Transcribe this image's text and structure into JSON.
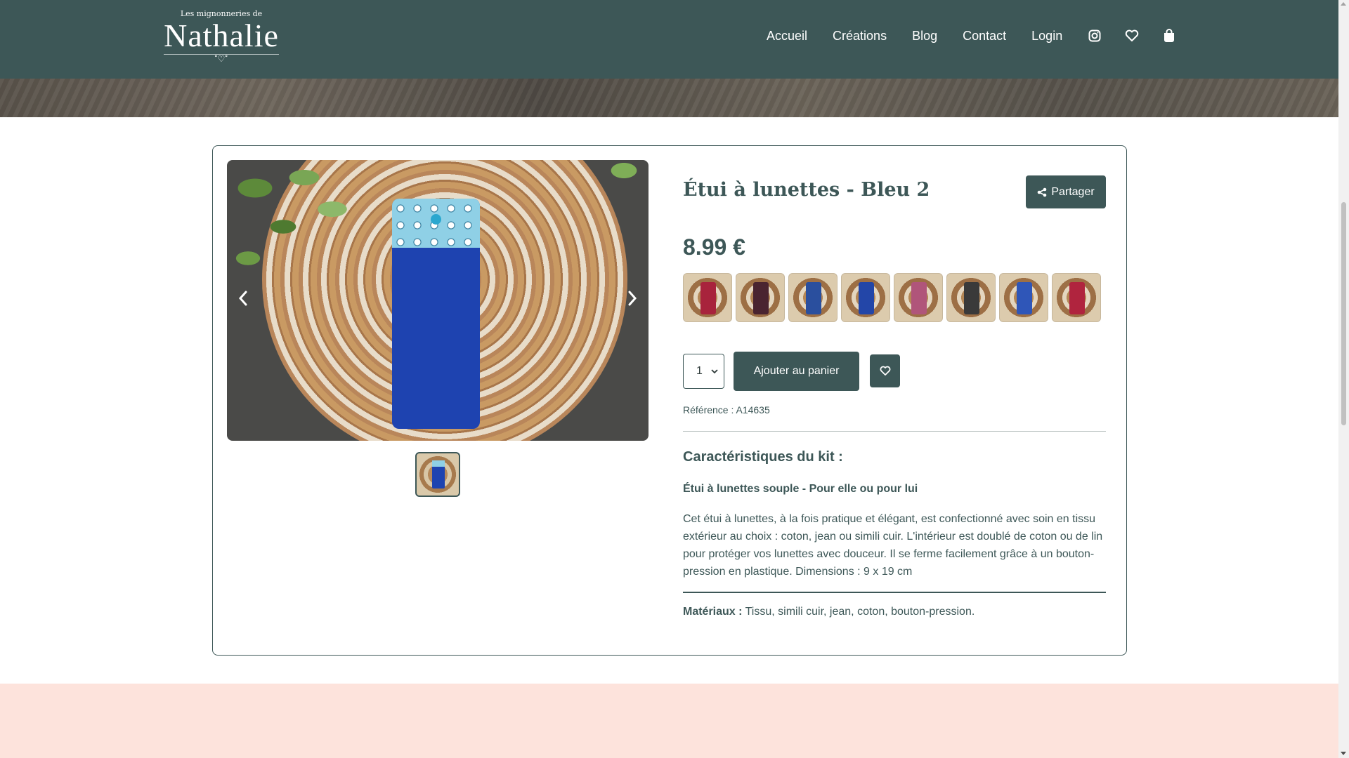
{
  "header": {
    "logo_small": "Les mignonneries de",
    "logo_big": "Nathalie",
    "logo_deco": "˚♡˚",
    "nav": [
      "Accueil",
      "Créations",
      "Blog",
      "Contact",
      "Login"
    ],
    "icons": [
      "instagram-icon",
      "heart-icon",
      "shopping-bag-icon"
    ]
  },
  "product": {
    "title": "Étui à lunettes - Bleu 2",
    "share_label": "Partager",
    "price": "8.99 €",
    "quantity": "1",
    "add_to_cart": "Ajouter au panier",
    "reference": "Référence : A14635",
    "section_title": "Caractéristiques du kit :",
    "subtitle": "Étui à lunettes souple - Pour elle ou pour lui",
    "description": "Cet étui à lunettes, à la fois pratique et élégant, est confectionné avec soin en tissu extérieur au choix : coton, jean ou simili cuir. L'intérieur est doublé de coton ou de lin pour protéger vos lunettes avec douceur. Il se ferme facilement grâce à un bouton-pression en plastique. Dimensions : 9 x 19 cm",
    "materials_label": "Matériaux :",
    "materials_value": " Tissu, simili cuir, jean, coton, bouton-pression."
  },
  "variants": [
    {
      "color": "#a8233c"
    },
    {
      "color": "#4a2430"
    },
    {
      "color": "#2a4f9e"
    },
    {
      "color": "#2346a8"
    },
    {
      "color": "#b0557a"
    },
    {
      "color": "#3a3a3a"
    },
    {
      "color": "#2f56b8"
    },
    {
      "color": "#b0243e"
    }
  ],
  "colors": {
    "primary": "#3d5757",
    "footer": "#fde3dc"
  }
}
